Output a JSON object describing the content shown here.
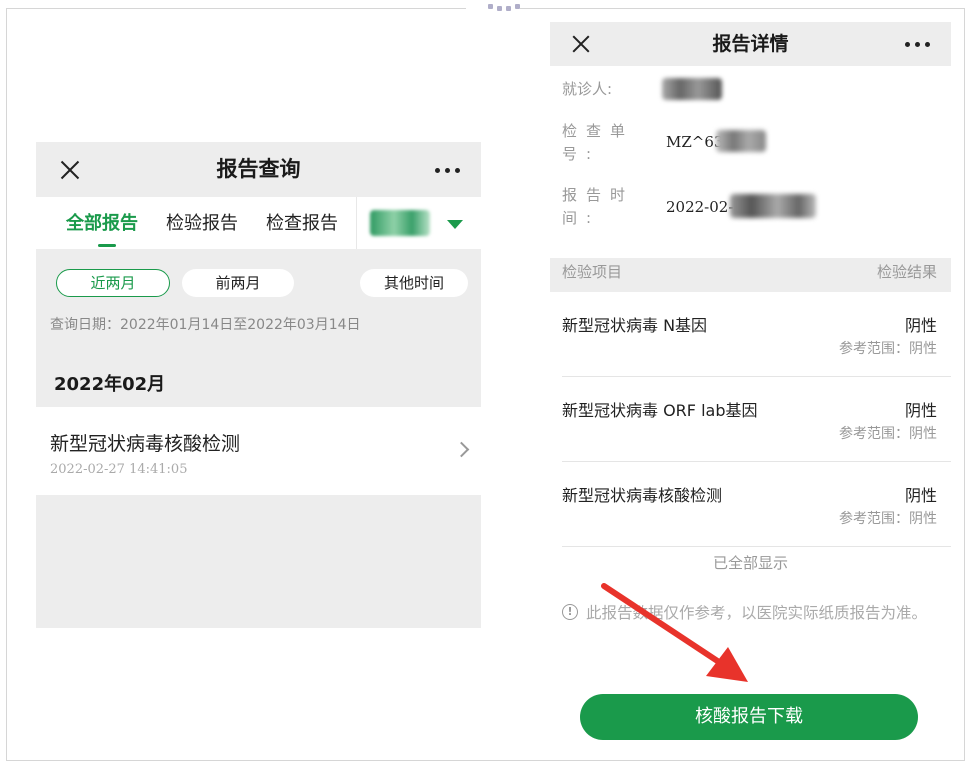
{
  "left_screen": {
    "nav": {
      "title": "报告查询",
      "close_icon": "close-icon",
      "more_icon": "more-icon"
    },
    "tabs": [
      {
        "label": "全部报告",
        "active": true
      },
      {
        "label": "检验报告",
        "active": false
      },
      {
        "label": "检查报告",
        "active": false
      }
    ],
    "filters": [
      {
        "label": "近两月",
        "active": true
      },
      {
        "label": "前两月",
        "active": false
      },
      {
        "label": "其他时间",
        "active": false
      }
    ],
    "query_date": "查询日期：2022年01月14日至2022年03月14日",
    "month_label": "2022年02月",
    "item": {
      "title": "新型冠状病毒核酸检测",
      "time": "2022-02-27 14:41:05"
    }
  },
  "right_screen": {
    "nav": {
      "title": "报告详情",
      "close_icon": "close-icon",
      "more_icon": "more-icon"
    },
    "info": {
      "patient_label": "就诊人:",
      "order_label": "检查单号:",
      "order_value": "MZ^63",
      "time_label": "报告时间:",
      "time_value": "2022-02-"
    },
    "table_header": {
      "left": "检验项目",
      "right": "检验结果"
    },
    "results": [
      {
        "name": "新型冠状病毒 N基因",
        "result": "阴性",
        "reference": "参考范围：阴性"
      },
      {
        "name": "新型冠状病毒 ORF lab基因",
        "result": "阴性",
        "reference": "参考范围：阴性"
      },
      {
        "name": "新型冠状病毒核酸检测",
        "result": "阴性",
        "reference": "参考范围：阴性"
      }
    ],
    "all_shown": "已全部显示",
    "notice": "此报告数据仅作参考，以医院实际纸质报告为准。",
    "download_button": "核酸报告下载"
  },
  "colors": {
    "brand_green": "#1a9a4b",
    "annotation_red": "#e8332b"
  }
}
